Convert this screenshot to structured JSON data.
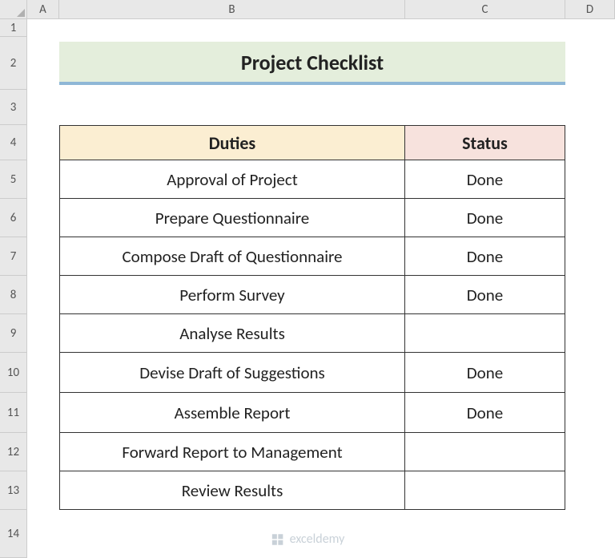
{
  "columns": [
    "A",
    "B",
    "C",
    "D"
  ],
  "rows": [
    "1",
    "2",
    "3",
    "4",
    "5",
    "6",
    "7",
    "8",
    "9",
    "10",
    "11",
    "12",
    "13",
    "14"
  ],
  "title": "Project Checklist",
  "headers": {
    "duties": "Duties",
    "status": "Status"
  },
  "table": [
    {
      "duty": "Approval of Project",
      "status": "Done"
    },
    {
      "duty": "Prepare Questionnaire",
      "status": "Done"
    },
    {
      "duty": "Compose Draft of Questionnaire",
      "status": "Done"
    },
    {
      "duty": "Perform Survey",
      "status": "Done"
    },
    {
      "duty": "Analyse Results",
      "status": ""
    },
    {
      "duty": "Devise Draft of Suggestions",
      "status": "Done"
    },
    {
      "duty": "Assemble Report",
      "status": "Done"
    },
    {
      "duty": "Forward Report to Management",
      "status": ""
    },
    {
      "duty": "Review Results",
      "status": ""
    }
  ],
  "watermark": "exceldemy"
}
